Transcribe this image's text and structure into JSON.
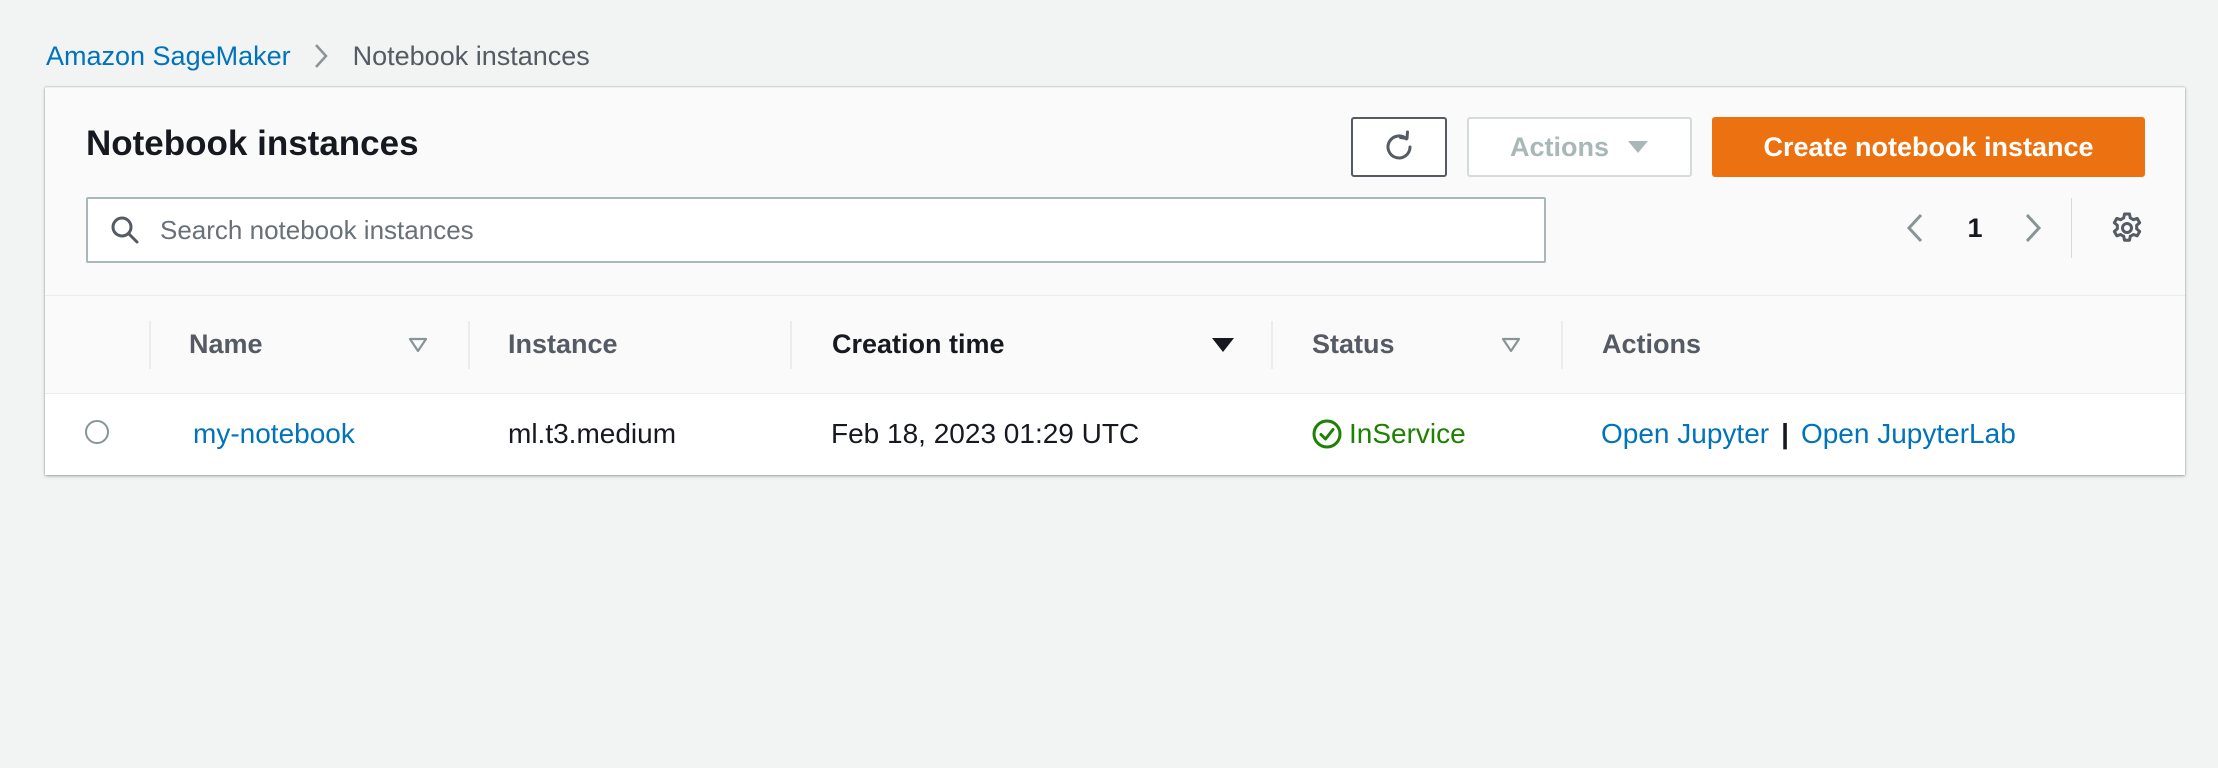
{
  "breadcrumb": {
    "root": "Amazon SageMaker",
    "current": "Notebook instances"
  },
  "panel": {
    "title": "Notebook instances",
    "actions_label": "Actions",
    "create_label": "Create notebook instance",
    "search_placeholder": "Search notebook instances",
    "search_value": "",
    "page": "1"
  },
  "table": {
    "columns": {
      "name": "Name",
      "instance": "Instance",
      "creation_time": "Creation time",
      "status": "Status",
      "actions": "Actions"
    },
    "rows": [
      {
        "name": "my-notebook",
        "instance": "ml.t3.medium",
        "creation_time": "Feb 18, 2023 01:29 UTC",
        "status": "InService",
        "open_jupyter": "Open Jupyter",
        "separator": "|",
        "open_jupyterlab": "Open JupyterLab"
      }
    ]
  },
  "colors": {
    "link": "#0073bb",
    "primary_button": "#ec7211",
    "success": "#1d8102",
    "background": "#f2f3f3"
  },
  "icons": {
    "breadcrumb_separator": "chevron-right-icon",
    "refresh": "refresh-icon",
    "actions_caret": "caret-down-icon",
    "search": "search-icon",
    "prev_page": "chevron-left-icon",
    "next_page": "chevron-right-icon",
    "settings": "gear-icon",
    "status": "check-circle-icon"
  }
}
